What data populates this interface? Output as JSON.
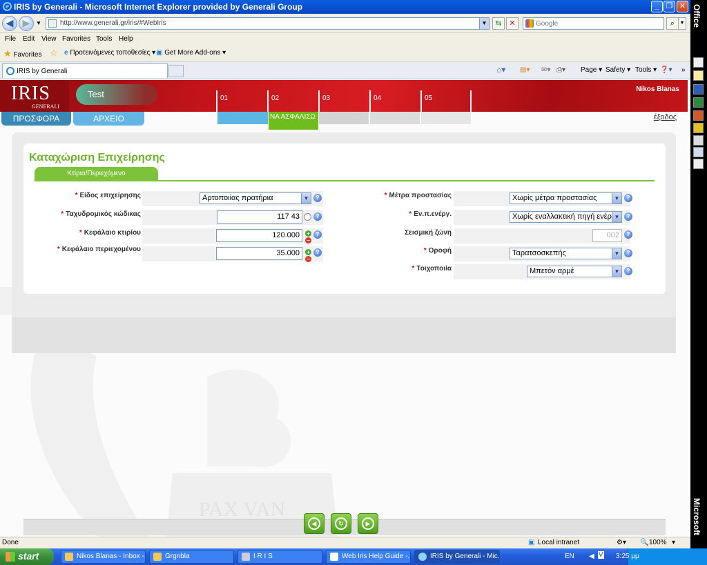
{
  "window": {
    "title": "IRIS by Generali - Microsoft Internet Explorer provided by Generali Group",
    "minimize": "_",
    "restore": "❐",
    "close": "✕"
  },
  "addressbar": {
    "url": "http://www.generali.gr/iris/#WebIris",
    "search_placeholder": "Google"
  },
  "menu": [
    "File",
    "Edit",
    "View",
    "Favorites",
    "Tools",
    "Help"
  ],
  "favbar": {
    "favorites": "Favorites",
    "suggested": "Προτεινόμενες τοποθεσίες ▾",
    "addons": "Get More Add-ons ▾"
  },
  "tabs": {
    "active": "IRIS by Generali"
  },
  "commandbar": {
    "page": "Page ▾",
    "safety": "Safety ▾",
    "tools": "Tools ▾"
  },
  "office": {
    "top": "Office",
    "bottom": "Microsoft"
  },
  "app": {
    "logo": "IRIS",
    "logo_sub": "GENERALI",
    "client": "Test",
    "steps": [
      "01",
      "02",
      "03",
      "04",
      "05"
    ],
    "step02_label": "ΝΑ ΑΣΦΑΛΙΣΩ",
    "user": "Nikos  Blanas",
    "tab_offer": "ΠΡΟΣΦΟΡΑ",
    "tab_archive": "ΑΡΧΕΙΟ",
    "logout": "έξοδος",
    "panel_title": "Καταχώριση Επιχείρησης",
    "subtab": "Κτίριο/Περιεχόμενο",
    "watermark_text": "PAX  VAN",
    "colors": {
      "brand_red": "#c3141a",
      "accent_green": "#7cc23a",
      "nav_blue": "#3a8ab8"
    }
  },
  "form_left": [
    {
      "label": "Είδος επιχείρησης",
      "type": "select",
      "value": "Αρτοποιίας πρατήρια"
    },
    {
      "label": "Ταχυδρομικός κώδικας",
      "type": "text",
      "value": "117 43"
    },
    {
      "label": "Κεφάλαιο κτιρίου",
      "type": "number",
      "value": "120.000"
    },
    {
      "label": "Κεφάλαιο περιεχομένου",
      "type": "number",
      "value": "35.000"
    }
  ],
  "form_right": [
    {
      "label": "Μέτρα προστασίας",
      "type": "select",
      "value": "Χωρίς μέτρα προστασίας"
    },
    {
      "label": "Εν.π.ενέργ.",
      "type": "select",
      "value": "Χωρίς εναλλακτική πηγή ενέργεια"
    },
    {
      "label": "Σεισμική ζώνη",
      "type": "readonly",
      "value": "002"
    },
    {
      "label": "Οροφή",
      "type": "select",
      "value": "Ταρατσοσκεπής"
    },
    {
      "label": "Τοιχοποιία",
      "type": "select",
      "value": "Μπετόν αρμέ"
    }
  ],
  "status": {
    "text": "Done",
    "zone": "Local intranet",
    "zoom": "100%"
  },
  "taskbar": {
    "start": "start",
    "items": [
      "Nikos Blanas - Inbox -...",
      "Grgnbla",
      "I R I S",
      "Web Iris Help Guide -...",
      "IRIS by Generali - Mic..."
    ],
    "lang": "EN",
    "time": "3:25 μμ"
  }
}
